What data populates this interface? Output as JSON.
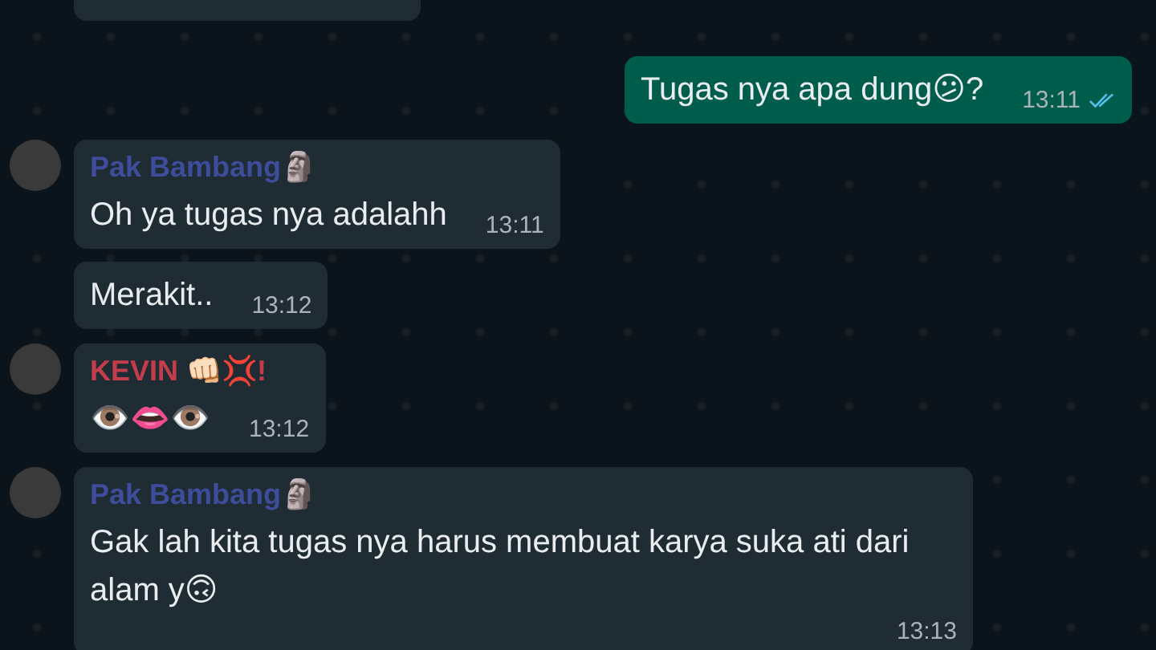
{
  "messages": [
    {
      "kind": "partial"
    },
    {
      "kind": "outgoing",
      "text": "Tugas nya apa dung😕?",
      "time": "13:11",
      "read": true
    },
    {
      "kind": "incoming",
      "avatar": true,
      "sender": {
        "name": "Pak Bambang🗿",
        "color": "#3d4d9c"
      },
      "text": "Oh ya tugas nya adalahh",
      "time": "13:11"
    },
    {
      "kind": "incoming",
      "avatar": false,
      "text": "Merakit..",
      "time": "13:12"
    },
    {
      "kind": "incoming",
      "avatar": true,
      "sender": {
        "name": "KEVIN 👊🏻💢!",
        "color": "#c33d4c"
      },
      "text": "👁️👄👁️",
      "time": "13:12"
    },
    {
      "kind": "incoming",
      "avatar": true,
      "sender": {
        "name": "Pak Bambang🗿",
        "color": "#3d4d9c"
      },
      "text": "Gak lah kita tugas nya harus membuat karya suka ati dari alam y🙃",
      "time": "13:13"
    }
  ]
}
